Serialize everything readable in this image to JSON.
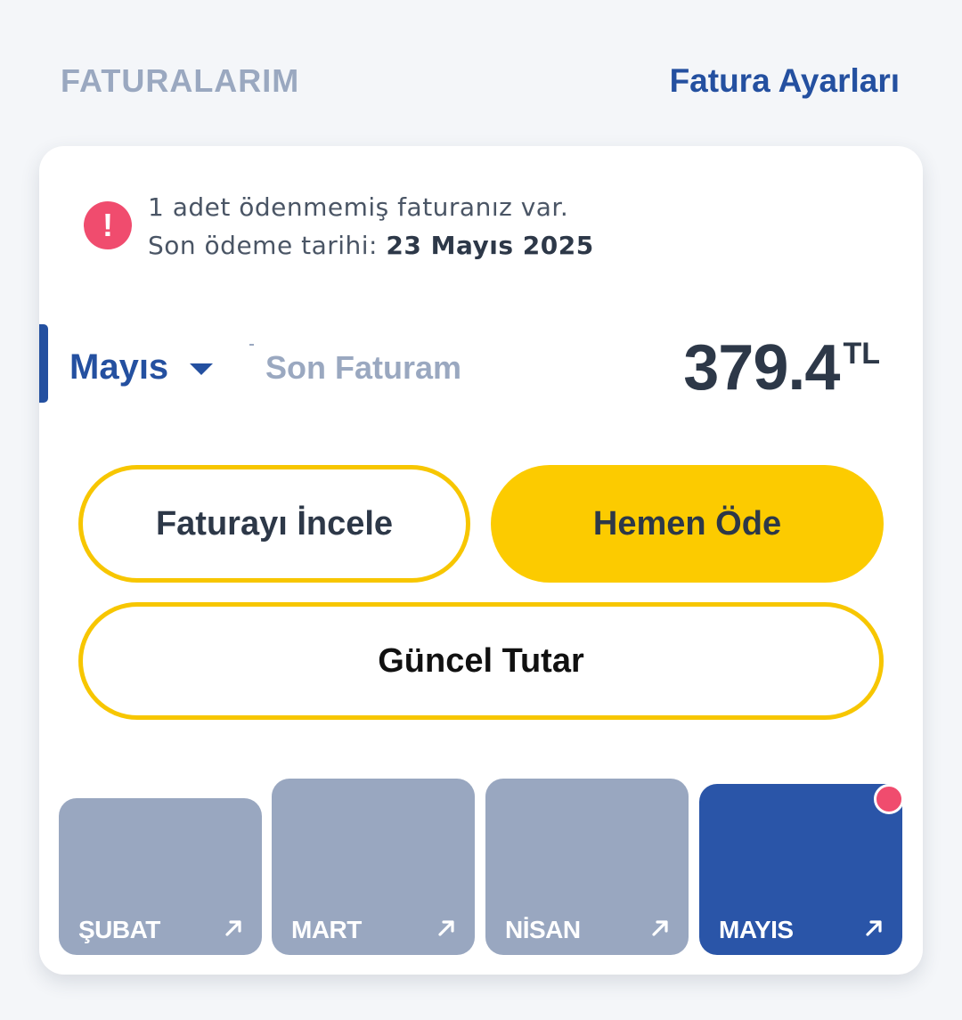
{
  "header": {
    "title": "FATURALARIM",
    "settings_link": "Fatura Ayarları"
  },
  "alert": {
    "icon": "exclamation-icon",
    "message": "1 adet ödenmemiş faturanız var.",
    "due_label": "Son ödeme tarihi: ",
    "due_date": "23 Mayıs 2025"
  },
  "bill": {
    "month": "Mayıs",
    "subtitle": "Son Faturam",
    "amount": "379.4",
    "currency": "TL"
  },
  "buttons": {
    "review": "Faturayı İncele",
    "pay": "Hemen Öde",
    "current": "Güncel Tutar"
  },
  "months": [
    {
      "label": "ŞUBAT",
      "selected": false,
      "unpaid": false
    },
    {
      "label": "MART",
      "selected": false,
      "unpaid": false
    },
    {
      "label": "NİSAN",
      "selected": false,
      "unpaid": false
    },
    {
      "label": "MAYIS",
      "selected": true,
      "unpaid": true
    }
  ],
  "colors": {
    "brand_blue": "#2450a0",
    "brand_yellow": "#fccb00",
    "alert_pink": "#f04c6e",
    "muted": "#99a7c0"
  }
}
